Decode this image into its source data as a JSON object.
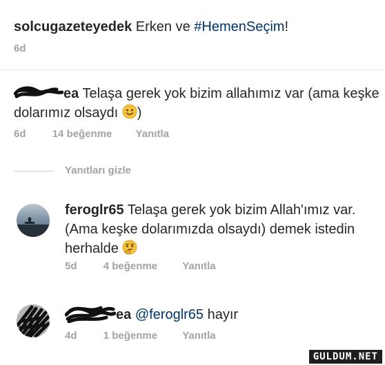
{
  "post": {
    "username": "solcugazeteyedek",
    "caption_text": "Erken ve",
    "hashtag": "#HemenSeçim",
    "caption_end": "!",
    "time": "6d"
  },
  "comment1": {
    "username_fragment": "ea",
    "text_line1": "Telaşa gerek yok bizim allahımız var (ama keşke",
    "text_line2": "dolarımız olsaydı",
    "text_end": ")",
    "emoji": "smiling-face",
    "time": "6d",
    "likes": "14 beğenme",
    "reply": "Yanıtla"
  },
  "replies_toggle": "Yanıtları gizle",
  "reply1": {
    "username": "feroglr65",
    "text_line1": "Telaşa gerek yok bizim Allah'ımız var.",
    "text_line2": "(Ama keşke dolarımızda olsaydı) demek istedin",
    "text_line3": "herhalde",
    "emoji": "thinking-face",
    "time": "5d",
    "likes": "4 beğenme",
    "reply": "Yanıtla"
  },
  "reply2": {
    "username_fragment": "ea",
    "mention": "@feroglr65",
    "text": "hayır",
    "time": "4d",
    "likes": "1 beğenme",
    "reply": "Yanıtla"
  },
  "watermark": "GULDUM.NET",
  "colors": {
    "text": "#262626",
    "meta": "#a3a3a3",
    "hashtag": "#003569",
    "divider": "#e6e6e6",
    "emoji": "#f5c33b"
  }
}
